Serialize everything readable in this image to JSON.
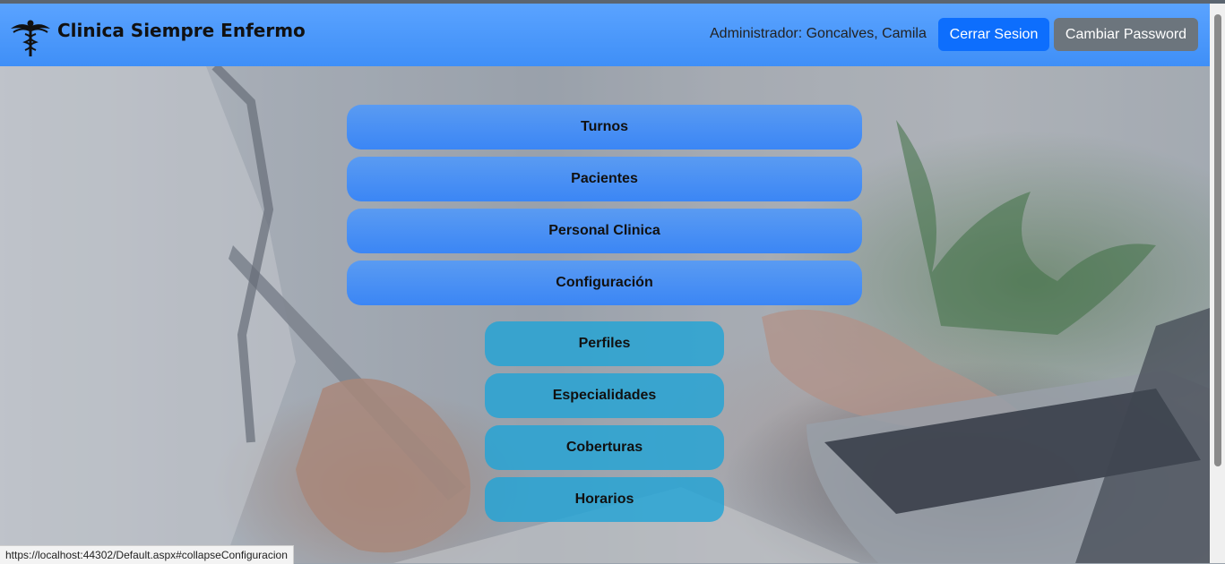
{
  "header": {
    "brand": "Clinica Siempre Enfermo",
    "logo_icon": "caduceus-icon",
    "user_label": "Administrador: Goncalves, Camila",
    "logout_label": "Cerrar Sesion",
    "change_password_label": "Cambiar Password"
  },
  "menu": {
    "items": [
      {
        "label": "Turnos"
      },
      {
        "label": "Pacientes"
      },
      {
        "label": "Personal Clinica"
      },
      {
        "label": "Configuración"
      }
    ],
    "submenu": [
      {
        "label": "Perfiles"
      },
      {
        "label": "Especialidades"
      },
      {
        "label": "Coberturas"
      },
      {
        "label": "Horarios"
      }
    ]
  },
  "status_bar": {
    "url": "https://localhost:44302/Default.aspx#collapseConfiguracion"
  },
  "colors": {
    "navbar": "#4a97fc",
    "logout_button": "#0d6efd",
    "password_button": "#6c757d",
    "menu_button": "#4a90f3",
    "submenu_button": "#22a4d6"
  }
}
